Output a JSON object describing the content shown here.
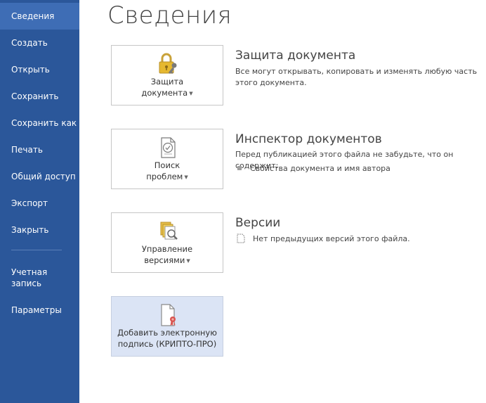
{
  "sidebar": {
    "items": [
      {
        "label": "Сведения"
      },
      {
        "label": "Создать"
      },
      {
        "label": "Открыть"
      },
      {
        "label": "Сохранить"
      },
      {
        "label": "Сохранить как"
      },
      {
        "label": "Печать"
      },
      {
        "label": "Общий доступ"
      },
      {
        "label": "Экспорт"
      },
      {
        "label": "Закрыть"
      },
      {
        "label": "Учетная запись"
      },
      {
        "label": "Параметры"
      }
    ]
  },
  "main": {
    "title": "Сведения",
    "sections": [
      {
        "tile_line1": "Защита",
        "tile_line2": "документа",
        "icon": "lock-key-icon",
        "title": "Защита документа",
        "text": "Все могут открывать, копировать и изменять любую часть этого документа."
      },
      {
        "tile_line1": "Поиск",
        "tile_line2": "проблем",
        "icon": "inspect-document-icon",
        "title": "Инспектор документов",
        "text": "Перед публикацией этого файла не забудьте, что он содержит:",
        "bullet": "Свойства документа и имя автора"
      },
      {
        "tile_line1": "Управление",
        "tile_line2": "версиями",
        "icon": "manage-versions-icon",
        "title": "Версии",
        "text": "Нет предыдущих версий этого файла."
      },
      {
        "tile_line1": "Добавить электронную",
        "tile_line2": "подпись (КРИПТО-ПРО)",
        "icon": "digital-signature-icon"
      }
    ]
  },
  "colors": {
    "sidebar_bg": "#2b579a",
    "sidebar_active": "#3e6db5",
    "highlight_tile": "#dbe4f5"
  }
}
